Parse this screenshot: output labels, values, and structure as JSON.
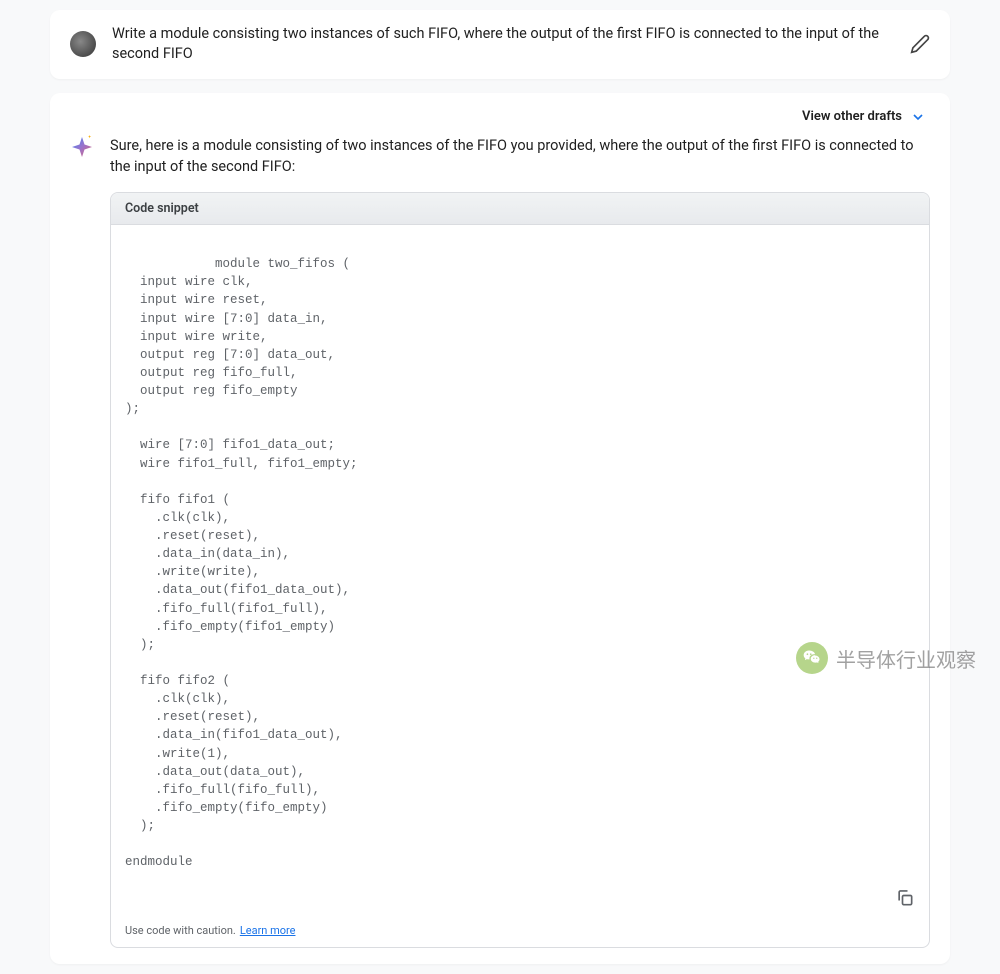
{
  "user_message": {
    "text": "Write a module consisting two instances of such FIFO, where the output of the first FIFO is connected to the input of the second FIFO"
  },
  "response": {
    "view_drafts_label": "View other drafts",
    "intro_text": "Sure, here is a module consisting of two instances of the FIFO you provided, where the output of the first FIFO is connected to the input of the second FIFO:",
    "code_header": "Code snippet",
    "code": "module two_fifos (\n  input wire clk,\n  input wire reset,\n  input wire [7:0] data_in,\n  input wire write,\n  output reg [7:0] data_out,\n  output reg fifo_full,\n  output reg fifo_empty\n);\n\n  wire [7:0] fifo1_data_out;\n  wire fifo1_full, fifo1_empty;\n\n  fifo fifo1 (\n    .clk(clk),\n    .reset(reset),\n    .data_in(data_in),\n    .write(write),\n    .data_out(fifo1_data_out),\n    .fifo_full(fifo1_full),\n    .fifo_empty(fifo1_empty)\n  );\n\n  fifo fifo2 (\n    .clk(clk),\n    .reset(reset),\n    .data_in(fifo1_data_out),\n    .write(1),\n    .data_out(data_out),\n    .fifo_full(fifo_full),\n    .fifo_empty(fifo_empty)\n  );\n\nendmodule",
    "caution_text": "Use code with caution.",
    "learn_more": "Learn more"
  },
  "watermark": {
    "text": "半导体行业观察"
  }
}
